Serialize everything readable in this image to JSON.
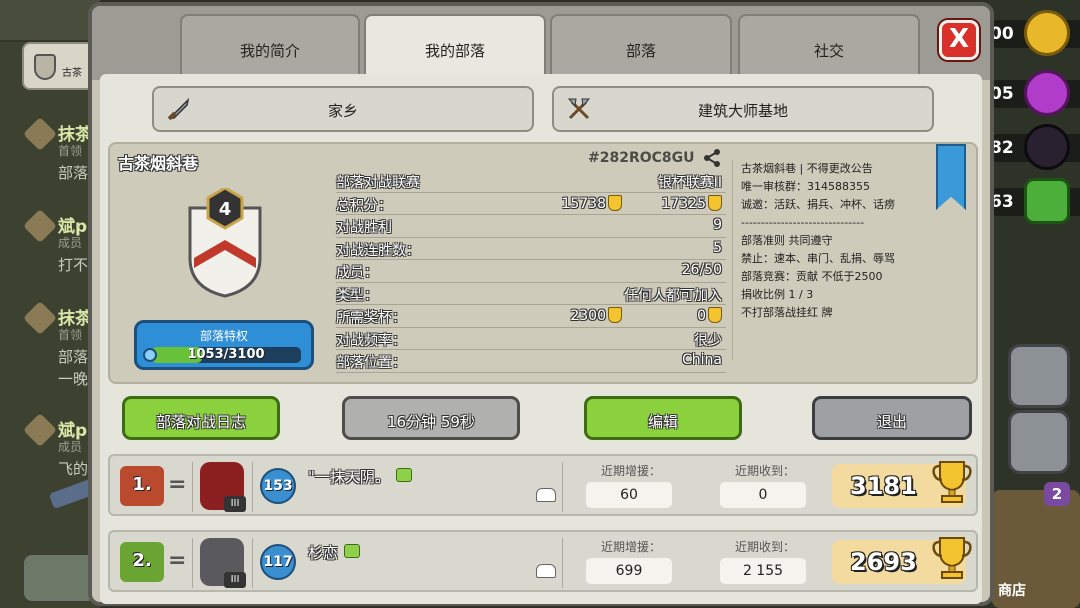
{
  "background": {
    "clan_tag_label": "古茶",
    "members": [
      {
        "name": "抹茶",
        "rank": "首领",
        "message": "部落"
      },
      {
        "name": "斌p",
        "rank": "成员",
        "message": "打不"
      },
      {
        "name": "抹茶",
        "rank": "首领",
        "message": "部落\n一晚"
      },
      {
        "name": "斌p",
        "rank": "成员",
        "message": "飞的"
      }
    ],
    "resources": [
      "00",
      "05",
      "82",
      "63"
    ],
    "shop_label": "商店",
    "shop_badge": "2"
  },
  "tabs": [
    {
      "label": "我的简介",
      "active": false
    },
    {
      "label": "我的部落",
      "active": true
    },
    {
      "label": "部落",
      "active": false
    },
    {
      "label": "社交",
      "active": false
    }
  ],
  "close_label": "X",
  "home_buttons": {
    "home": "家乡",
    "builder": "建筑大师基地"
  },
  "clan": {
    "name": "古茶烟斜巷",
    "tag": "#282ROC8GU",
    "level": "4",
    "perks_label": "部落特权",
    "perks_progress": "1053/3100",
    "perks_fraction": 0.34,
    "stats": [
      {
        "key": "部落对战联赛",
        "value": "银杯联赛II"
      },
      {
        "key": "总积分：",
        "value": "17325",
        "value2": "15738"
      },
      {
        "key": "对战胜利",
        "value": "9"
      },
      {
        "key": "对战连胜数：",
        "value": "5"
      },
      {
        "key": "成员：",
        "value": "26/50"
      },
      {
        "key": "类型：",
        "value": "任何人都可加入"
      },
      {
        "key": "所需奖杯：",
        "value": "0",
        "value2": "2300"
      },
      {
        "key": "对战频率：",
        "value": "很少"
      },
      {
        "key": "部落位置：",
        "value": "China"
      }
    ],
    "description": [
      "古茶烟斜巷 | 不得更改公告",
      "唯一审核群：314588355",
      "诚邀：活跃、捐兵、冲杯、话痨",
      "-------------------------------",
      "部落准则 共同遵守",
      "禁止：速本、串门、乱捐、辱骂",
      "部落竞赛：贡献 不低于2500",
      "捐收比例 1 / 3",
      "不打部落战挂红 牌"
    ]
  },
  "actions": {
    "war_log": "部落对战日志",
    "timer": "16分钟 59秒",
    "edit": "编辑",
    "leave": "退出"
  },
  "member_rows": [
    {
      "rank": "1.",
      "change": "=",
      "league_level": "III",
      "xp": "153",
      "name": "\"一抹天阴。",
      "donated_label": "近期增援：",
      "donated": "60",
      "received_label": "近期收到：",
      "received": "0",
      "trophies": "3181"
    },
    {
      "rank": "2.",
      "change": "=",
      "league_level": "III",
      "xp": "117",
      "name": "杉恋",
      "donated_label": "近期增援：",
      "donated": "699",
      "received_label": "近期收到：",
      "received": "2 155",
      "trophies": "2693"
    }
  ]
}
